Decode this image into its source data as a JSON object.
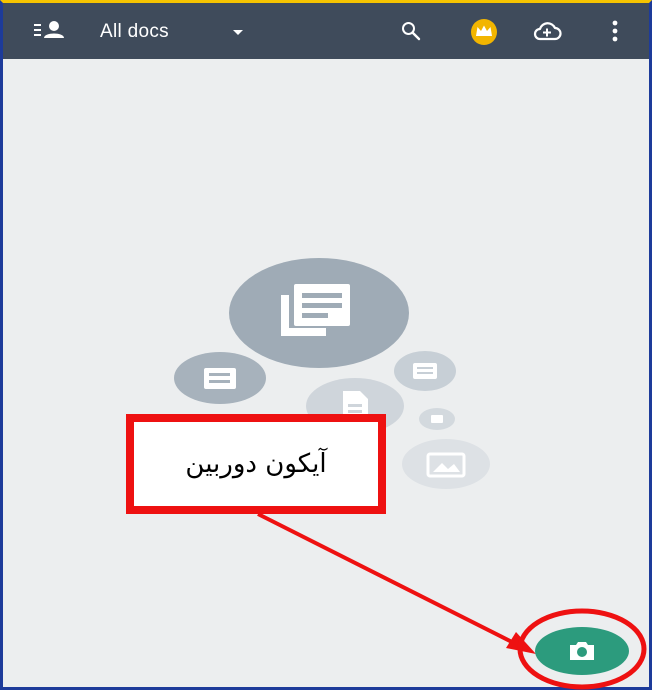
{
  "header": {
    "title": "All docs",
    "icons": [
      "filter-user-icon",
      "dropdown-caret-icon",
      "search-icon",
      "crown-badge-icon",
      "cloud-upload-icon",
      "more-vert-icon"
    ]
  },
  "empty_state": {
    "illustration": "documents-cluster-illustration"
  },
  "annotation": {
    "label": "آیکون دوربین",
    "color": "#ee1111"
  },
  "fab": {
    "icon": "camera-icon",
    "color": "#2c9b7d"
  },
  "colors": {
    "toolbar": "#3f4b5b",
    "background": "#eceeef",
    "accent_gold": "#f2b500"
  }
}
